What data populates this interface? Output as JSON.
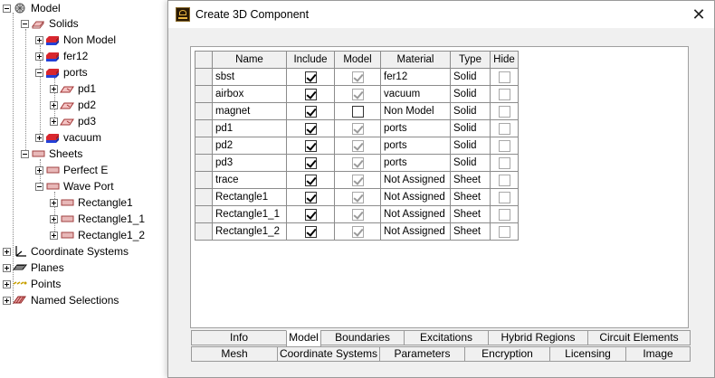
{
  "tree": {
    "model": "Model",
    "solids": "Solids",
    "non_model": "Non Model",
    "fer12": "fer12",
    "ports": "ports",
    "pd1": "pd1",
    "pd2": "pd2",
    "pd3": "pd3",
    "vacuum": "vacuum",
    "sheets": "Sheets",
    "perfect_e": "Perfect E",
    "wave_port": "Wave Port",
    "rect1": "Rectangle1",
    "rect1_1": "Rectangle1_1",
    "rect1_2": "Rectangle1_2",
    "coordinate_systems": "Coordinate Systems",
    "planes": "Planes",
    "points": "Points",
    "named_selections": "Named Selections"
  },
  "dialog": {
    "title": "Create 3D Component",
    "close_glyph": "✕"
  },
  "grid": {
    "columns": [
      "Name",
      "Include",
      "Model",
      "Material",
      "Type",
      "Hide"
    ],
    "rows": [
      {
        "name": "sbst",
        "include": true,
        "model": true,
        "material": "fer12",
        "type": "Solid",
        "hide": false
      },
      {
        "name": "airbox",
        "include": true,
        "model": true,
        "material": "vacuum",
        "type": "Solid",
        "hide": false
      },
      {
        "name": "magnet",
        "include": true,
        "model": false,
        "material": "Non Model",
        "type": "Solid",
        "hide": false
      },
      {
        "name": "pd1",
        "include": true,
        "model": true,
        "material": "ports",
        "type": "Solid",
        "hide": false
      },
      {
        "name": "pd2",
        "include": true,
        "model": true,
        "material": "ports",
        "type": "Solid",
        "hide": false
      },
      {
        "name": "pd3",
        "include": true,
        "model": true,
        "material": "ports",
        "type": "Solid",
        "hide": false
      },
      {
        "name": "trace",
        "include": true,
        "model": true,
        "material": "Not Assigned",
        "type": "Sheet",
        "hide": false
      },
      {
        "name": "Rectangle1",
        "include": true,
        "model": true,
        "material": "Not Assigned",
        "type": "Sheet",
        "hide": false
      },
      {
        "name": "Rectangle1_1",
        "include": true,
        "model": true,
        "material": "Not Assigned",
        "type": "Sheet",
        "hide": false
      },
      {
        "name": "Rectangle1_2",
        "include": true,
        "model": true,
        "material": "Not Assigned",
        "type": "Sheet",
        "hide": false
      }
    ]
  },
  "tabs": {
    "info": "Info",
    "model": "Model",
    "boundaries": "Boundaries",
    "excitations": "Excitations",
    "hybrid_regions": "Hybrid Regions",
    "circuit_elements": "Circuit Elements",
    "mesh": "Mesh",
    "coordinate_systems": "Coordinate Systems",
    "parameters": "Parameters",
    "encryption": "Encryption",
    "licensing": "Licensing",
    "image": "Image",
    "active": "Model"
  },
  "colors": {
    "solid_red": "#d9262e",
    "solid_blue": "#2340d8",
    "port_fill": "#f4c4c4",
    "sheet_fill": "#e8b8b8"
  }
}
